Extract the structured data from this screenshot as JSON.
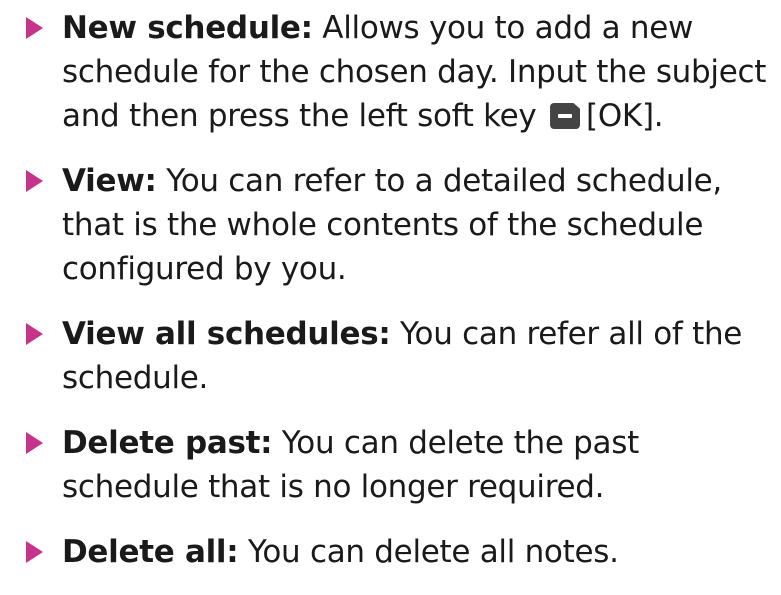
{
  "items": [
    {
      "term": "New schedule:",
      "desc_before_key": " Allows you to add a new schedule for the chosen day. Input the subject and then press the left soft key ",
      "key_icon": "left-soft-key-icon",
      "desc_after_key": "[OK]."
    },
    {
      "term": "View:",
      "desc": " You can refer to a detailed schedule, that is the whole contents of the schedule configured by you."
    },
    {
      "term": "View all schedules:",
      "desc": " You can refer all of the schedule."
    },
    {
      "term": "Delete past:",
      "desc": " You can delete the past schedule that is no longer required."
    },
    {
      "term": "Delete all:",
      "desc": " You can delete all notes."
    }
  ],
  "colors": {
    "bullet": "#c8338a",
    "text": "#1a1a1a",
    "key": "#444444"
  },
  "bullet_icon": "triangle-right-icon"
}
